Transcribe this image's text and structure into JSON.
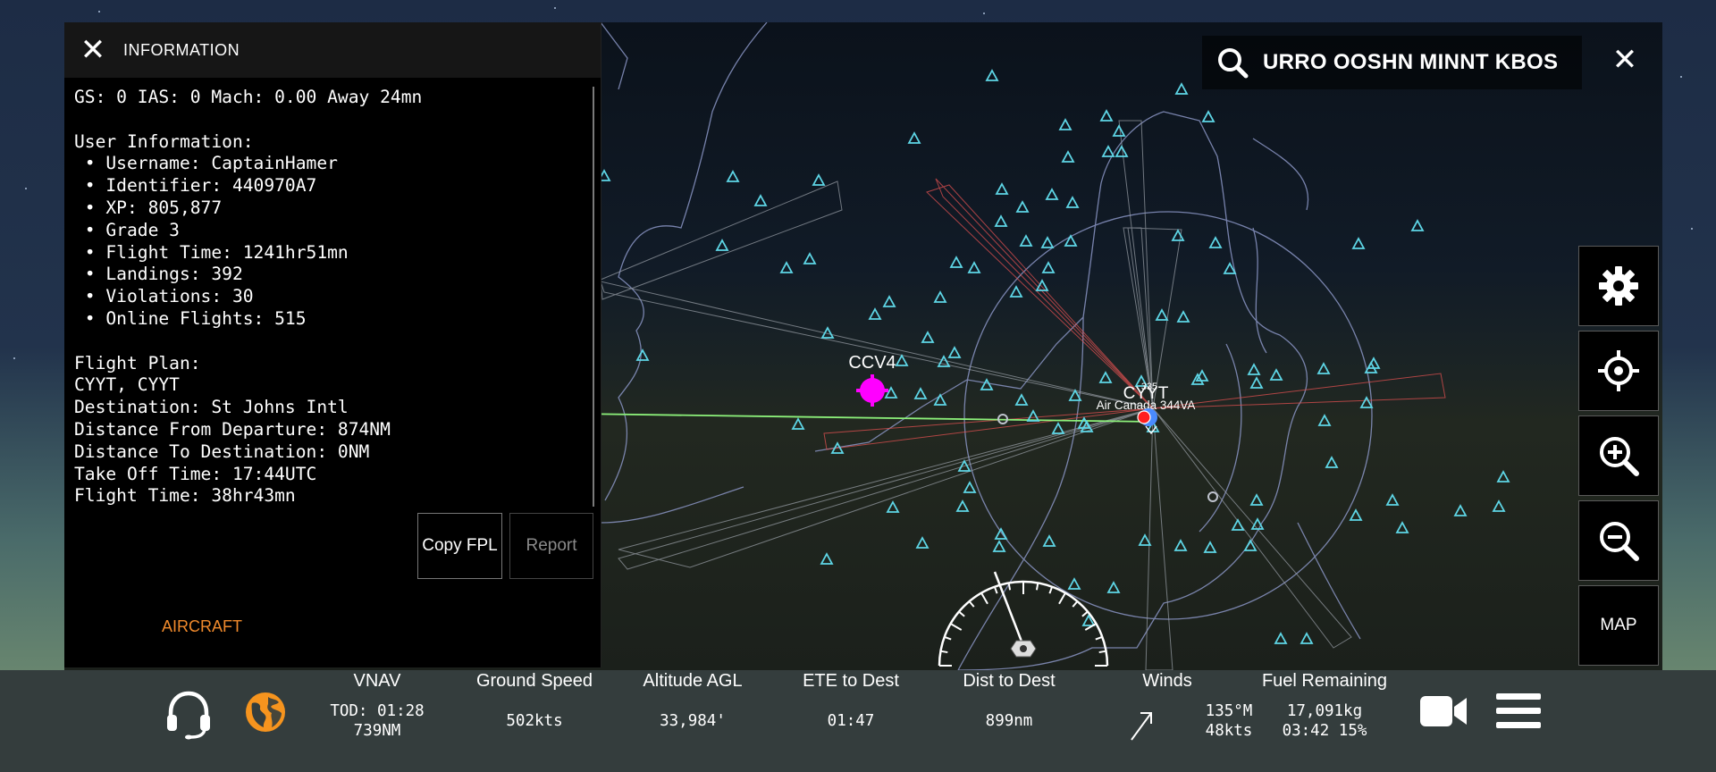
{
  "info_panel": {
    "title": "INFORMATION",
    "close_icon": "close-x-icon",
    "lines": [
      "GS: 0 IAS: 0 Mach: 0.00 Away 24mn",
      "",
      "User Information:",
      " • Username: CaptainHamer",
      " • Identifier: 440970A7",
      " • XP: 805,877",
      " • Grade 3",
      " • Flight Time: 1241hr51mn",
      " • Landings: 392",
      " • Violations: 30",
      " • Online Flights: 515",
      "",
      "Flight Plan:",
      "CYYT, CYYT",
      "Destination: St Johns Intl",
      "Distance From Departure: 874NM",
      "Distance To Destination: 0NM",
      "Take Off Time: 17:44UTC",
      "Flight Time: 38hr43mn"
    ],
    "copy_fpl_label": "Copy FPL",
    "report_label": "Report",
    "aircraft_tab_label": "AIRCRAFT",
    "aircraft_tab_color": "#f08a2c"
  },
  "map": {
    "search_text": "URRO OOSHN MINNT KBOS",
    "search_icon": "search-icon",
    "close_icon": "close-x-icon",
    "waypoint_label": "CCV4",
    "airport_label": "CYYT",
    "heading_tag": "335",
    "aircraft_label": "Air Canada 344VA",
    "waypoint_color": "#ff00ff",
    "navaid_color": "#5ed6e6",
    "route_color": "#8cf07a",
    "aircraft_color": "#ff1f1f",
    "controls": {
      "settings_icon": "gear-icon",
      "locate_icon": "crosshair-icon",
      "zoom_in_icon": "zoom-in-icon",
      "zoom_out_icon": "zoom-out-icon",
      "map_label": "MAP"
    }
  },
  "bottom_bar": {
    "headset_icon": "headset-icon",
    "globe_icon": "globe-icon",
    "globe_color": "#f6941e",
    "stats": {
      "vnav": {
        "label": "VNAV",
        "line1": "TOD: 01:28",
        "line2": "739NM"
      },
      "ground_speed": {
        "label": "Ground Speed",
        "value": "502kts"
      },
      "altitude": {
        "label": "Altitude AGL",
        "value": "33,984'"
      },
      "ete": {
        "label": "ETE to Dest",
        "value": "01:47"
      },
      "dist": {
        "label": "Dist to Dest",
        "value": "899nm"
      },
      "winds": {
        "label": "Winds",
        "line1": "135°M",
        "line2": "48kts",
        "arrow_icon": "wind-arrow-icon"
      },
      "fuel": {
        "label": "Fuel Remaining",
        "line1": "17,091kg",
        "line2": "03:42 15%"
      }
    },
    "camera_icon": "video-camera-icon",
    "menu_icon": "hamburger-menu-icon"
  }
}
